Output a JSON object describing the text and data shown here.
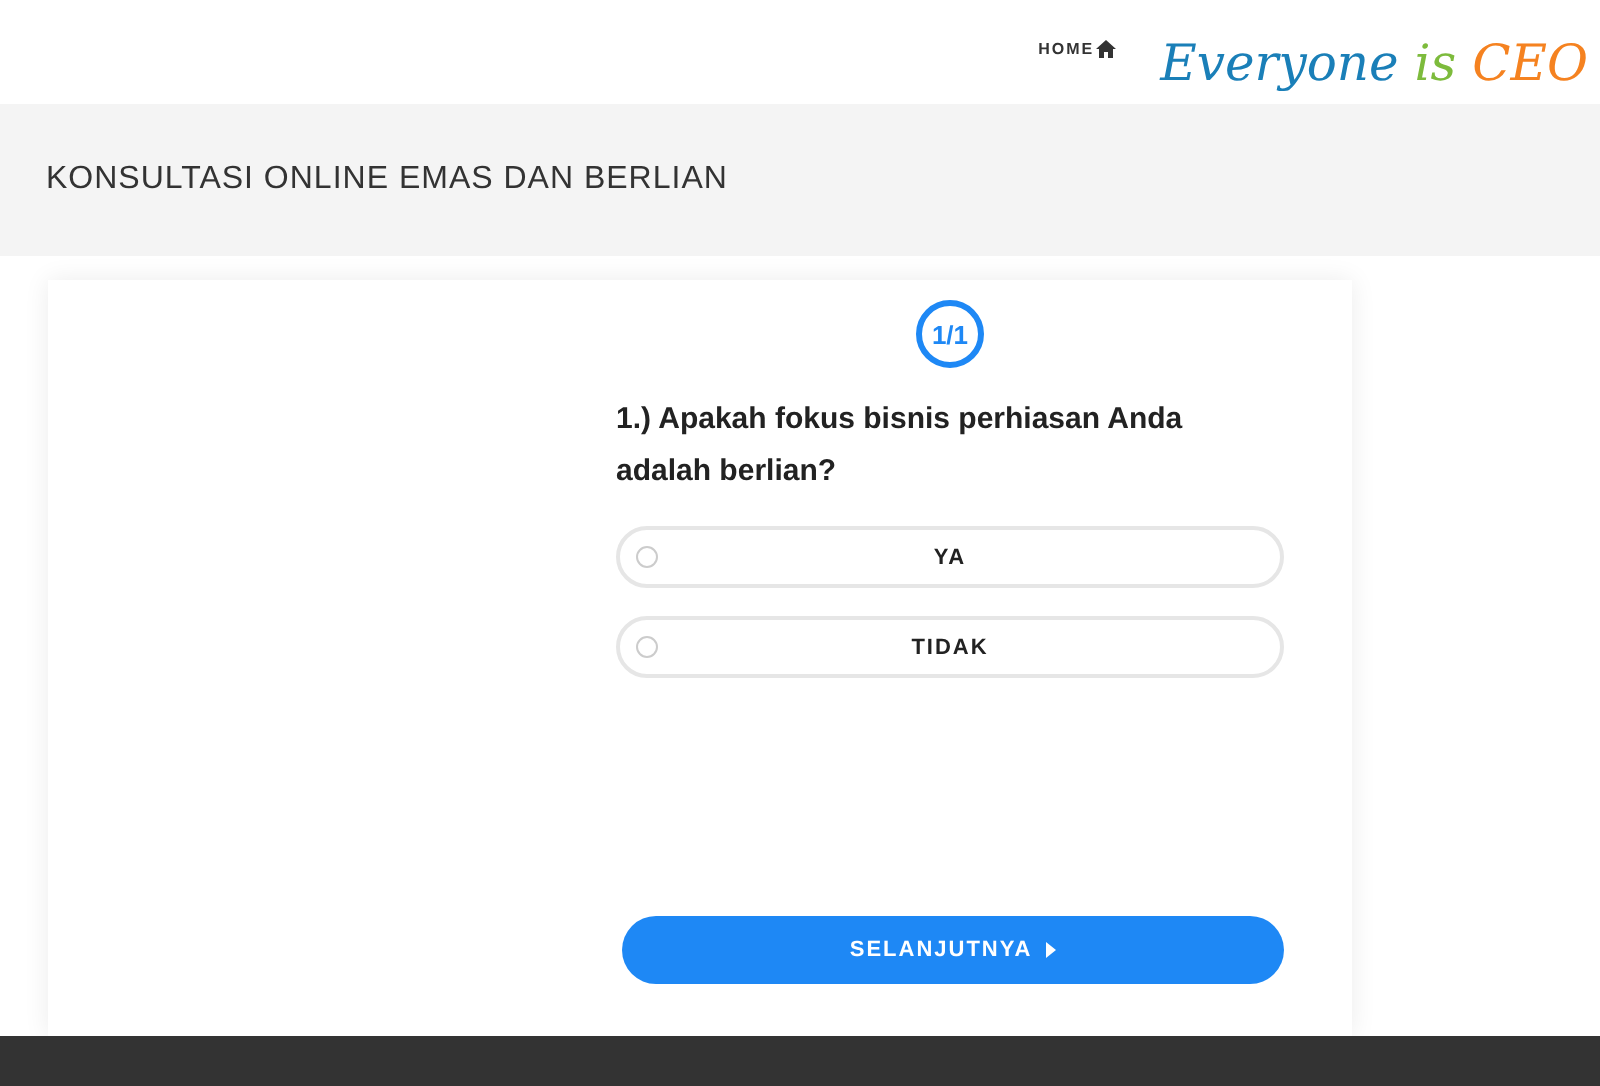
{
  "nav": {
    "home": "HOME"
  },
  "logo": [
    {
      "text": "Everyone",
      "color": "#1a7fb8"
    },
    {
      "text": "is",
      "color": "#7dbb3c"
    },
    {
      "text": "CEO",
      "color": "#f58220"
    }
  ],
  "page_title": "KONSULTASI ONLINE EMAS DAN BERLIAN",
  "quiz": {
    "progress": "1/1",
    "question": "1.) Apakah fokus bisnis perhiasan Anda adalah berlian?",
    "options": [
      {
        "label": "YA",
        "selected": false
      },
      {
        "label": "TIDAK",
        "selected": false
      }
    ],
    "next_button": "SELANJUTNYA"
  }
}
